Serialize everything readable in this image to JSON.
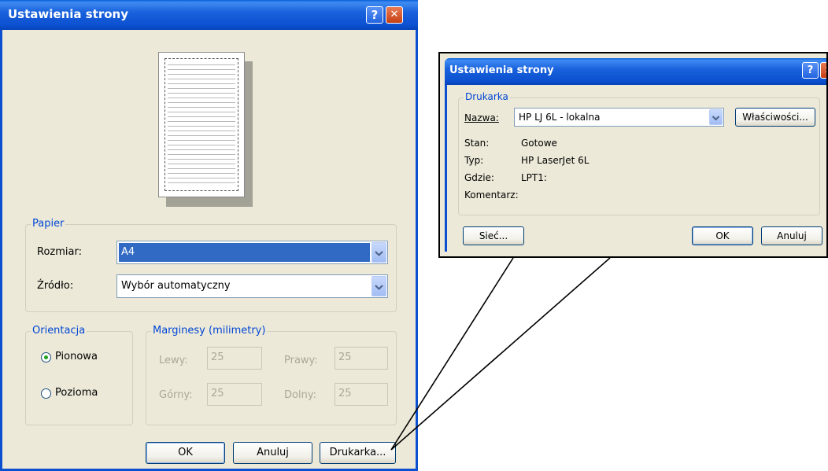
{
  "main_dialog": {
    "title": "Ustawienia strony",
    "help_button": "?",
    "close_button": "✕",
    "paper": {
      "group_label": "Papier",
      "size_label": "Rozmiar:",
      "size_value": "A4",
      "source_label": "Źródło:",
      "source_value": "Wybór automatyczny"
    },
    "orientation": {
      "group_label": "Orientacja",
      "portrait_label": "Pionowa",
      "landscape_label": "Pozioma",
      "selected": "Pionowa"
    },
    "margins": {
      "group_label": "Marginesy (milimetry)",
      "left_label": "Lewy:",
      "left_value": "25",
      "right_label": "Prawy:",
      "right_value": "25",
      "top_label": "Górny:",
      "top_value": "25",
      "bottom_label": "Dolny:",
      "bottom_value": "25"
    },
    "buttons": {
      "ok": "OK",
      "cancel": "Anuluj",
      "printer": "Drukarka..."
    }
  },
  "printer_dialog": {
    "title": "Ustawienia strony",
    "help_button": "?",
    "close_button": "✕",
    "group_label": "Drukarka",
    "name_label": "Nazwa:",
    "name_value": "HP LJ 6L - lokalna",
    "properties_button": "Właściwości...",
    "status_label": "Stan:",
    "status_value": "Gotowe",
    "type_label": "Typ:",
    "type_value": "HP LaserJet 6L",
    "where_label": "Gdzie:",
    "where_value": "LPT1:",
    "comment_label": "Komentarz:",
    "comment_value": "",
    "buttons": {
      "network": "Sieć...",
      "ok": "OK",
      "cancel": "Anuluj"
    }
  },
  "colors": {
    "titlebar": "#0b50d0",
    "dialog_bg": "#ece9d8",
    "group_label": "#0046d5",
    "selection": "#316ac5"
  }
}
